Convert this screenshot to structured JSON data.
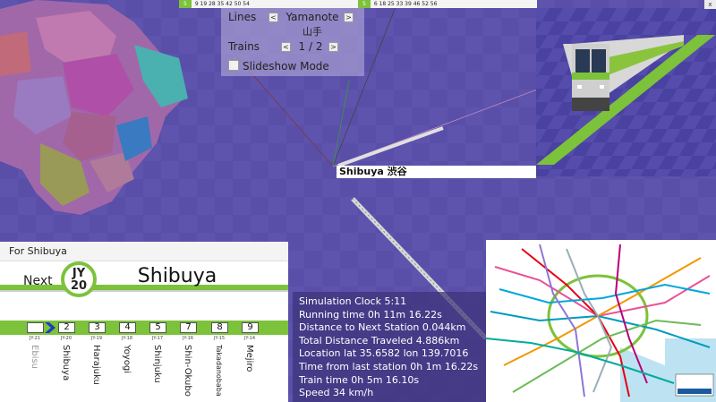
{
  "top_strip_left": {
    "highlight": "5",
    "numbers": "9 19 28 35 42 50 54"
  },
  "top_strip_right": {
    "highlight": "5",
    "numbers": "6 18 25 33 39 46 52 56"
  },
  "close_label": "x",
  "controls": {
    "lines_label": "Lines",
    "line_name": "Yamanote",
    "line_name_jp": "山手",
    "trains_label": "Trains",
    "train_value": "1 / 2",
    "prev": "<",
    "next": ">",
    "slideshow_label": "Slideshow Mode"
  },
  "station_label": "Shibuya 渋谷",
  "indicator": {
    "for_text": "For Shibuya",
    "next_label": "Next",
    "badge_line": "JY",
    "badge_number": "20",
    "next_station": "Shibuya",
    "stops": [
      {
        "code": "JY-21",
        "number": "",
        "name": "Ebisu"
      },
      {
        "code": "JY-20",
        "number": "2",
        "name": "Shibuya"
      },
      {
        "code": "JY-19",
        "number": "3",
        "name": "Harajuku"
      },
      {
        "code": "JY-18",
        "number": "4",
        "name": "Yoyogi"
      },
      {
        "code": "JY-17",
        "number": "5",
        "name": "Shinjuku"
      },
      {
        "code": "JY-16",
        "number": "7",
        "name": "Shin-Okubo"
      },
      {
        "code": "JY-15",
        "number": "8",
        "name": "Takadanobaba"
      },
      {
        "code": "JY-14",
        "number": "9",
        "name": "Mejiro"
      }
    ]
  },
  "info": {
    "clock": "Simulation Clock 5:11",
    "running": "Running time 0h 11m 16.22s",
    "distance_next": "Distance to Next Station 0.044km",
    "distance_total": "Total Distance Traveled 4.886km",
    "location": "Location lat 35.6582 lon 139.7016",
    "since_last": "Time from last station 0h 1m 16.22s",
    "train_time": "Train time 0h 5m 16.10s",
    "speed": "Speed 34 km/h"
  },
  "colors": {
    "yamanote_green": "#7cc23a",
    "scene_purple": "#5a4fa8"
  }
}
